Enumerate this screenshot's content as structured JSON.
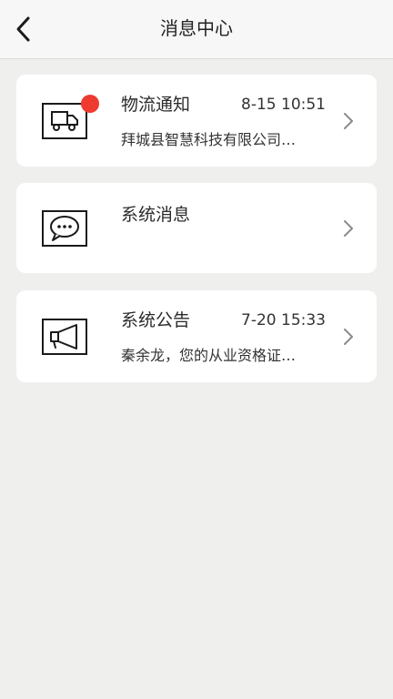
{
  "header": {
    "title": "消息中心",
    "back_icon": "chevron-left-icon"
  },
  "messages": [
    {
      "icon": "truck-icon",
      "title": "物流通知",
      "time": "8-15 10:51",
      "preview": "拜城县智慧科技有限公司…",
      "unread_badge": true,
      "badge_color": "#ee3a2f"
    },
    {
      "icon": "chat-bubble-icon",
      "title": "系统消息",
      "time": "",
      "preview": "",
      "unread_badge": false
    },
    {
      "icon": "megaphone-icon",
      "title": "系统公告",
      "time": "7-20 15:33",
      "preview": "秦余龙，您的从业资格证…",
      "unread_badge": false
    }
  ],
  "colors": {
    "background": "#eff0ee",
    "card": "#ffffff",
    "badge": "#ee3a2f",
    "chevron": "#8a8a8a"
  }
}
